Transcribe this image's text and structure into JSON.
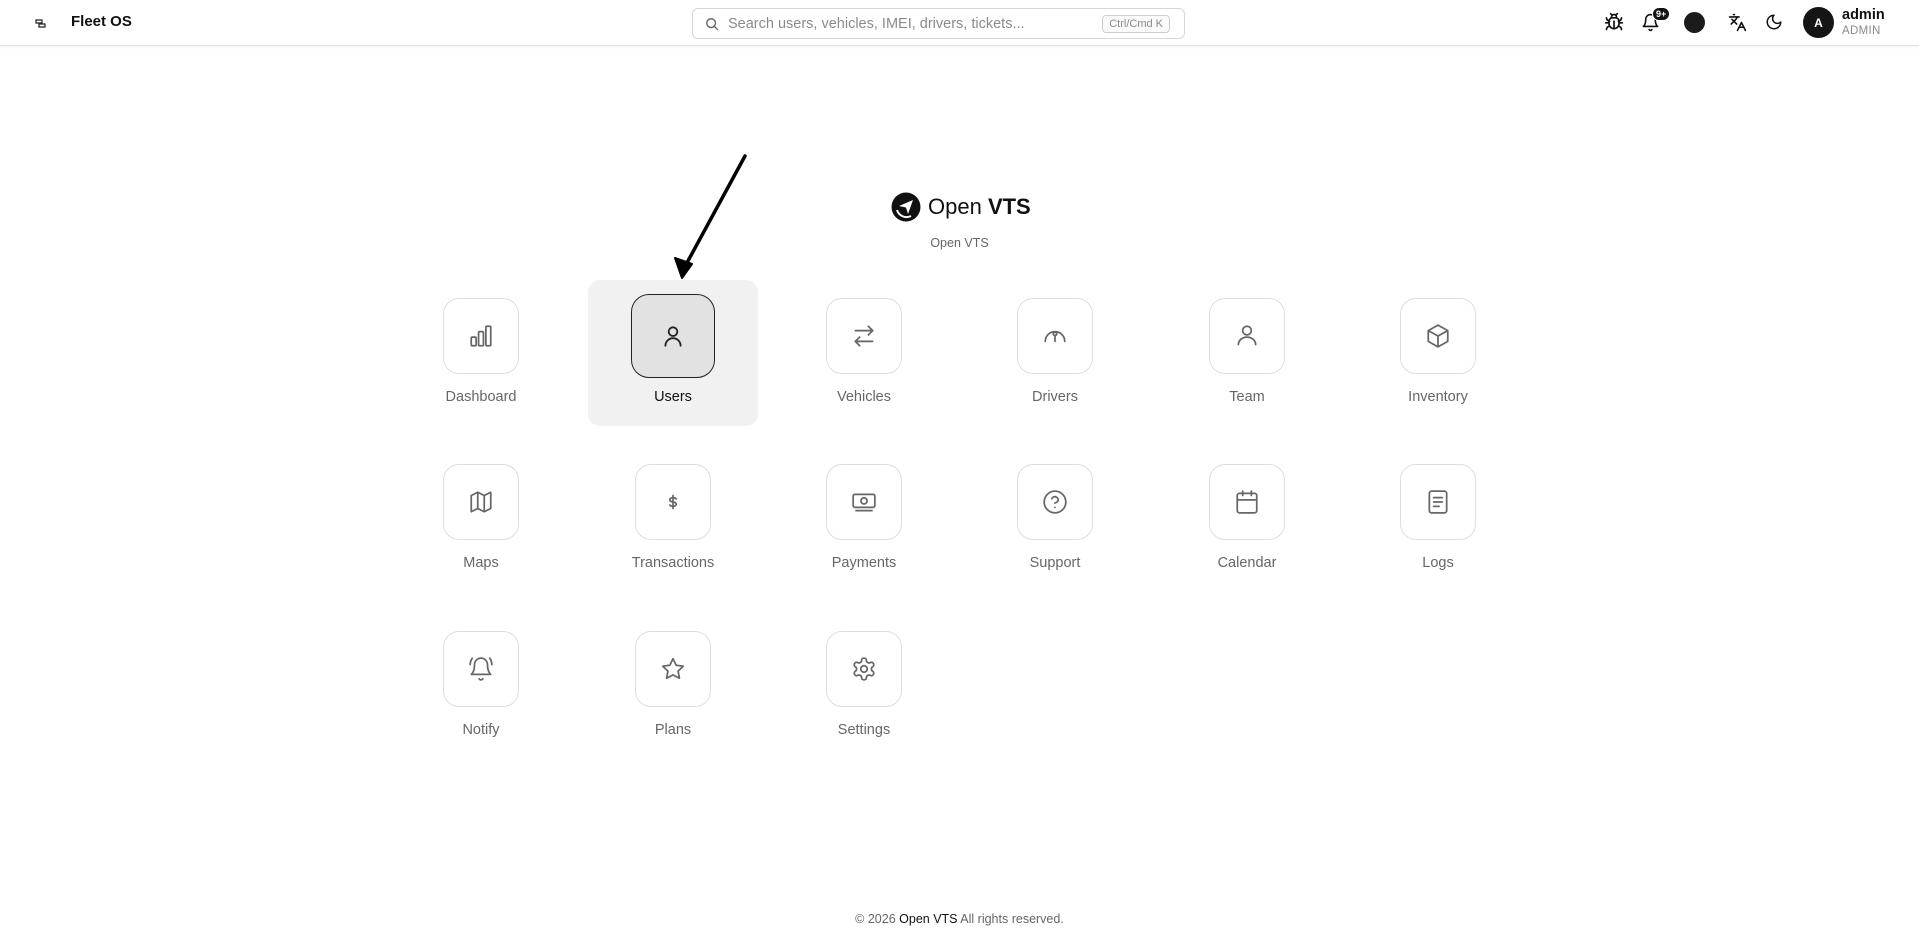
{
  "header": {
    "app_title": "Fleet OS",
    "search": {
      "placeholder": "Search users, vehicles, IMEI, drivers, tickets...",
      "shortcut": "Ctrl/Cmd K"
    },
    "notifications_badge": "9+",
    "user": {
      "avatar_letter": "A",
      "name": "admin",
      "role": "ADMIN"
    }
  },
  "brand": {
    "name_prefix": "Open ",
    "name_bold": "VTS",
    "subtitle": "Open VTS"
  },
  "modules": [
    {
      "label": "Dashboard",
      "icon": "bar-chart-icon"
    },
    {
      "label": "Users",
      "icon": "user-icon"
    },
    {
      "label": "Vehicles",
      "icon": "swap-arrows-icon"
    },
    {
      "label": "Drivers",
      "icon": "steering-wheel-icon"
    },
    {
      "label": "Team",
      "icon": "team-user-icon"
    },
    {
      "label": "Inventory",
      "icon": "box-icon"
    },
    {
      "label": "Maps",
      "icon": "map-icon"
    },
    {
      "label": "Transactions",
      "icon": "dollar-sign-icon"
    },
    {
      "label": "Payments",
      "icon": "banknote-icon"
    },
    {
      "label": "Support",
      "icon": "help-circle-icon"
    },
    {
      "label": "Calendar",
      "icon": "calendar-icon"
    },
    {
      "label": "Logs",
      "icon": "document-icon"
    },
    {
      "label": "Notify",
      "icon": "bell-ringing-icon"
    },
    {
      "label": "Plans",
      "icon": "star-icon"
    },
    {
      "label": "Settings",
      "icon": "gear-icon"
    }
  ],
  "footer": {
    "prefix": "© 2026 ",
    "brand": "Open VTS",
    "suffix": " All rights reserved."
  }
}
